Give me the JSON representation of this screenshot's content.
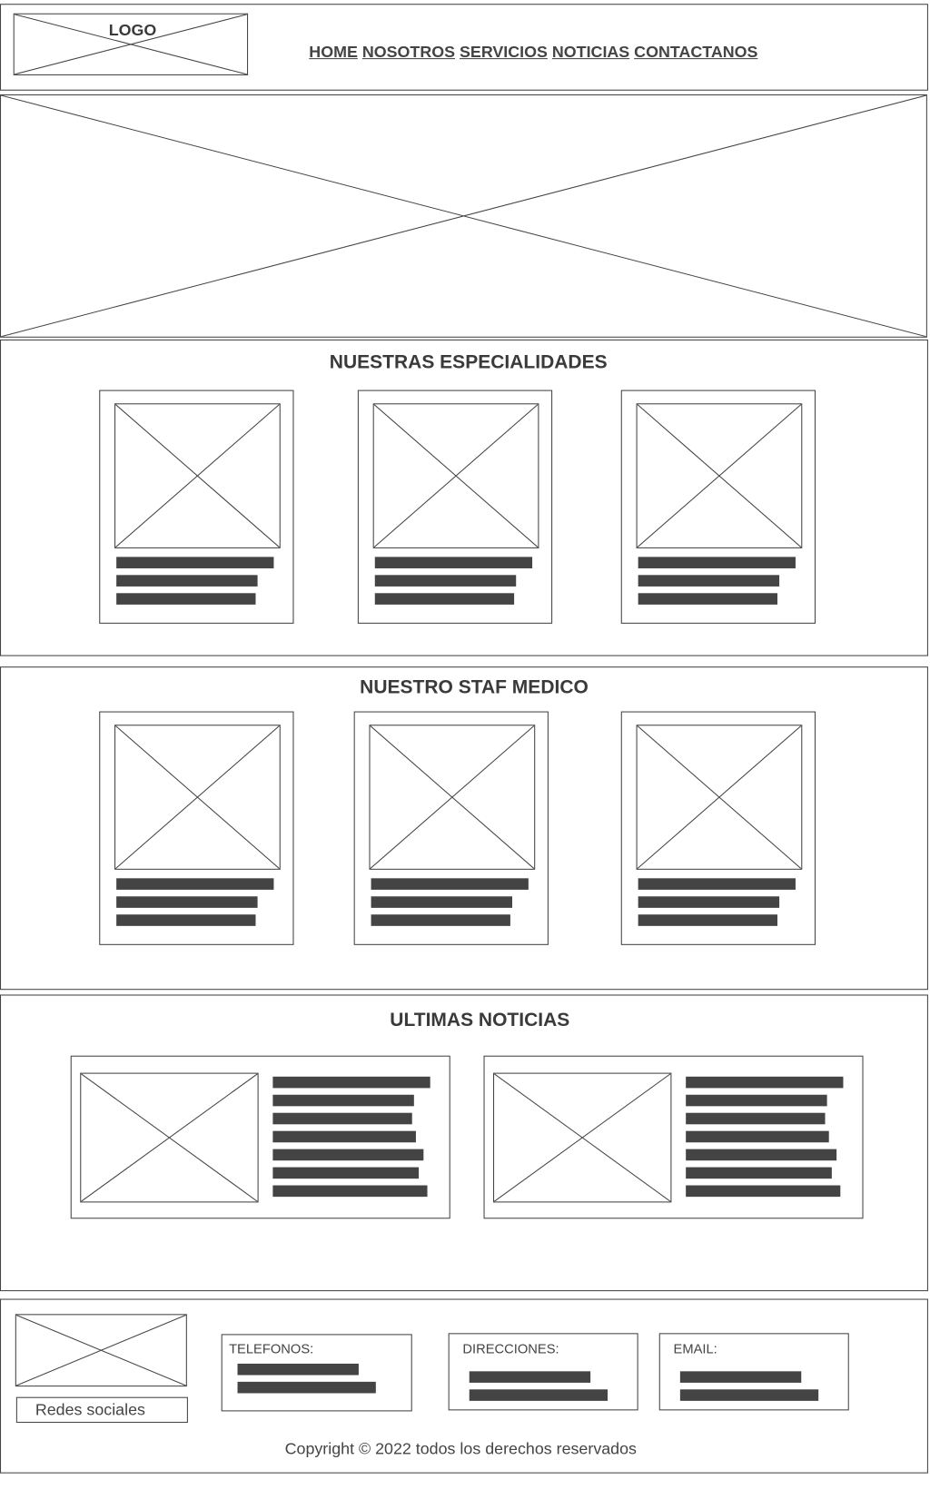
{
  "header": {
    "logo_text": "LOGO",
    "nav": [
      "HOME",
      "NOSOTROS",
      "SERVICIOS",
      "NOTICIAS",
      "CONTACTANOS"
    ]
  },
  "sections": {
    "specialties_title": "NUESTRAS ESPECIALIDADES",
    "staff_title": "NUESTRO STAF MEDICO",
    "news_title": "ULTIMAS NOTICIAS"
  },
  "footer": {
    "social_label": "Redes sociales",
    "phones_label": "TELEFONOS:",
    "addresses_label": "DIRECCIONES:",
    "email_label": "EMAIL:",
    "copyright": "Copyright © 2022 todos los derechos reservados"
  },
  "colors": {
    "line": "#444444",
    "bar": "#444444",
    "text": "#3a3a3a"
  }
}
